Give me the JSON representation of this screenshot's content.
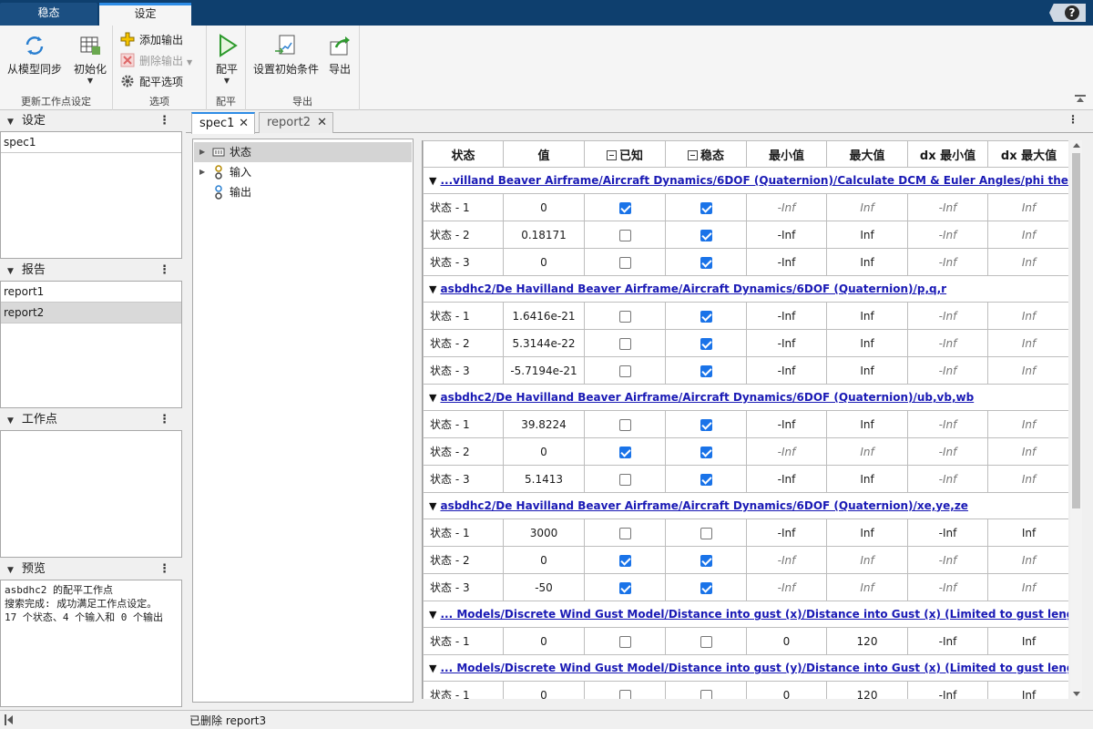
{
  "tabs": {
    "steady": "稳态",
    "settings": "设定"
  },
  "help": "?",
  "ribbon": {
    "sync": "从模型同步",
    "init": "初始化",
    "group1": "更新工作点设定",
    "add_output": "添加输出",
    "del_output": "删除输出",
    "trim_options": "配平选项",
    "group2": "选项",
    "trim": "配平",
    "group3": "配平",
    "set_ic": "设置初始条件",
    "export": "导出",
    "group4": "导出"
  },
  "left": {
    "settings_title": "设定",
    "settings_items": [
      "spec1"
    ],
    "report_title": "报告",
    "report_items": [
      "report1",
      "report2"
    ],
    "op_title": "工作点",
    "preview_title": "预览",
    "preview_lines": [
      "asbdhc2 的配平工作点",
      "搜索完成: 成功满足工作点设定。",
      "17 个状态、4 个输入和 0 个输出"
    ]
  },
  "doctabs": {
    "spec1": "spec1",
    "report2": "report2",
    "close": "✕"
  },
  "tree": {
    "states": "状态",
    "inputs": "输入",
    "outputs": "输出"
  },
  "grid": {
    "headers": [
      "状态",
      "值",
      "已知",
      "稳态",
      "最小值",
      "最大值",
      "dx 最小值",
      "dx 最大值"
    ],
    "groups": [
      {
        "title": "...villand Beaver Airframe/Aircraft Dynamics/6DOF (Quaternion)/Calculate DCM & Euler Angles/phi theta psi",
        "rows": [
          {
            "name": "状态 - 1",
            "value": "0",
            "known": true,
            "steady": true,
            "min": "-Inf",
            "max": "Inf",
            "dxmin": "-Inf",
            "dxmax": "Inf",
            "mi": true,
            "xi": true
          },
          {
            "name": "状态 - 2",
            "value": "0.18171",
            "known": false,
            "steady": true,
            "min": "-Inf",
            "max": "Inf",
            "dxmin": "-Inf",
            "dxmax": "Inf",
            "mi": false,
            "xi": false
          },
          {
            "name": "状态 - 3",
            "value": "0",
            "known": false,
            "steady": true,
            "min": "-Inf",
            "max": "Inf",
            "dxmin": "-Inf",
            "dxmax": "Inf",
            "mi": false,
            "xi": false
          }
        ]
      },
      {
        "title": "asbdhc2/De Havilland Beaver Airframe/Aircraft Dynamics/6DOF (Quaternion)/p,q,r",
        "rows": [
          {
            "name": "状态 - 1",
            "value": "1.6416e-21",
            "known": false,
            "steady": true,
            "min": "-Inf",
            "max": "Inf",
            "dxmin": "-Inf",
            "dxmax": "Inf",
            "mi": false,
            "xi": false
          },
          {
            "name": "状态 - 2",
            "value": "5.3144e-22",
            "known": false,
            "steady": true,
            "min": "-Inf",
            "max": "Inf",
            "dxmin": "-Inf",
            "dxmax": "Inf",
            "mi": false,
            "xi": false
          },
          {
            "name": "状态 - 3",
            "value": "-5.7194e-21",
            "known": false,
            "steady": true,
            "min": "-Inf",
            "max": "Inf",
            "dxmin": "-Inf",
            "dxmax": "Inf",
            "mi": false,
            "xi": false
          }
        ]
      },
      {
        "title": "asbdhc2/De Havilland Beaver Airframe/Aircraft Dynamics/6DOF (Quaternion)/ub,vb,wb",
        "rows": [
          {
            "name": "状态 - 1",
            "value": "39.8224",
            "known": false,
            "steady": true,
            "min": "-Inf",
            "max": "Inf",
            "dxmin": "-Inf",
            "dxmax": "Inf",
            "mi": false,
            "xi": false
          },
          {
            "name": "状态 - 2",
            "value": "0",
            "known": true,
            "steady": true,
            "min": "-Inf",
            "max": "Inf",
            "dxmin": "-Inf",
            "dxmax": "Inf",
            "mi": true,
            "xi": true
          },
          {
            "name": "状态 - 3",
            "value": "5.1413",
            "known": false,
            "steady": true,
            "min": "-Inf",
            "max": "Inf",
            "dxmin": "-Inf",
            "dxmax": "Inf",
            "mi": false,
            "xi": false
          }
        ]
      },
      {
        "title": "asbdhc2/De Havilland Beaver Airframe/Aircraft Dynamics/6DOF (Quaternion)/xe,ye,ze",
        "rows": [
          {
            "name": "状态 - 1",
            "value": "3000",
            "known": false,
            "steady": false,
            "min": "-Inf",
            "max": "Inf",
            "dxmin": "-Inf",
            "dxmax": "Inf",
            "mi": false,
            "xi": false,
            "dxplain": true
          },
          {
            "name": "状态 - 2",
            "value": "0",
            "known": true,
            "steady": true,
            "min": "-Inf",
            "max": "Inf",
            "dxmin": "-Inf",
            "dxmax": "Inf",
            "mi": true,
            "xi": true
          },
          {
            "name": "状态 - 3",
            "value": "-50",
            "known": true,
            "steady": true,
            "min": "-Inf",
            "max": "Inf",
            "dxmin": "-Inf",
            "dxmax": "Inf",
            "mi": true,
            "xi": true
          }
        ]
      },
      {
        "title": "... Models/Discrete Wind Gust Model/Distance into gust (x)/Distance into Gust (x) (Limited to gust length d)",
        "rows": [
          {
            "name": "状态 - 1",
            "value": "0",
            "known": false,
            "steady": false,
            "min": "0",
            "max": "120",
            "dxmin": "-Inf",
            "dxmax": "Inf",
            "mi": false,
            "xi": false,
            "dxplain": true
          }
        ]
      },
      {
        "title": "... Models/Discrete Wind Gust Model/Distance into gust (y)/Distance into Gust (x) (Limited to gust length d)",
        "rows": [
          {
            "name": "状态 - 1",
            "value": "0",
            "known": false,
            "steady": false,
            "min": "0",
            "max": "120",
            "dxmin": "-Inf",
            "dxmax": "Inf",
            "mi": false,
            "xi": false,
            "dxplain": true
          }
        ]
      }
    ]
  },
  "status": "已删除 report3"
}
